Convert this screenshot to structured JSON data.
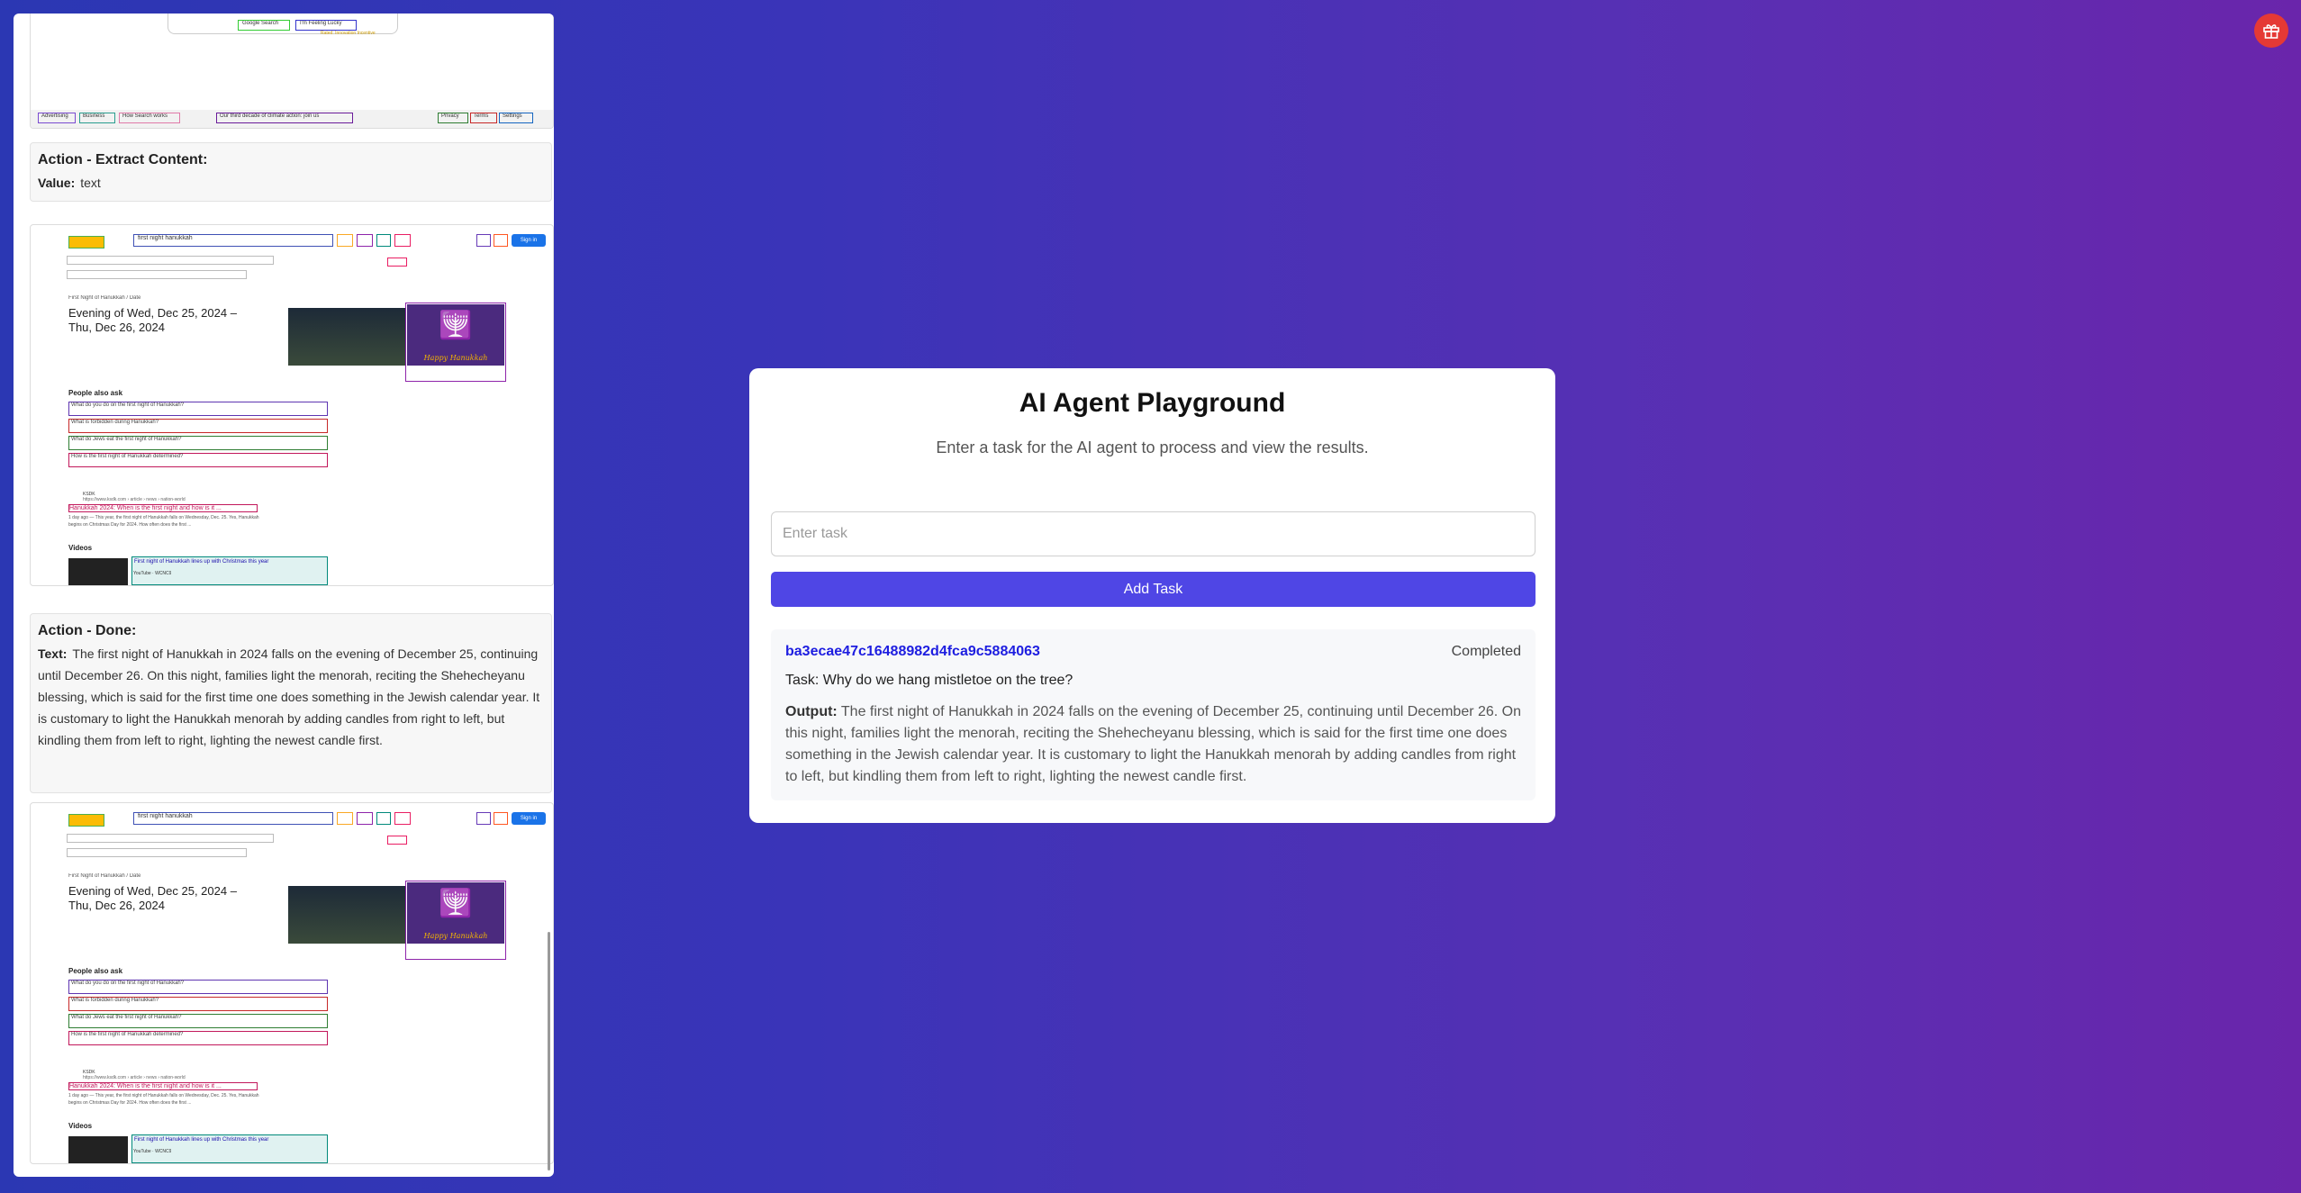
{
  "left_panel": {
    "top_shot": {
      "buttons": [
        "Google Search",
        "I'm Feeling Lucky"
      ],
      "footer_links": [
        "Advertising",
        "Business",
        "How Search works",
        "Our third decade of climate action: join us",
        "Privacy",
        "Terms",
        "Settings"
      ],
      "notice": "Rated: Innovation Incentive"
    },
    "extract_action": {
      "title": "Action - Extract Content:",
      "value_label": "Value:",
      "value": "text"
    },
    "search_shot": {
      "query": "first night hanukkah",
      "sign_in": "Sign in",
      "breadcrumb": "First Night of Hanukkah  /  Date",
      "date_heading_1": "Evening of Wed, Dec 25, 2024 –",
      "date_heading_2": "Thu, Dec 26, 2024",
      "people_also_ask": "People also ask",
      "questions": [
        "What do you do on the first night of Hanukkah?",
        "What is forbidden during Hanukkah?",
        "What do Jews eat the first night of Hanukkah?",
        "How is the first night of Hanukkah determined?"
      ],
      "result_source": "KSDK",
      "result_url": "https://www.ksdk.com › article › news › nation-world",
      "result_title": "Hanukkah 2024: When is the first night and how is it ...",
      "result_snippet_1": "1 day ago — This year, the first night of Hanukkah falls on Wednesday, Dec. 25. Yes, Hanukkah",
      "result_snippet_2": "begins on Christmas Day for 2024. How often does the first ...",
      "videos": "Videos",
      "video_title": "First night of Hanukkah lines up with Christmas this year",
      "video_source": "YouTube · WCNC9",
      "menorah_text": "Happy Hanukkah"
    },
    "done_action": {
      "title": "Action - Done:",
      "text_label": "Text:",
      "text": "The first night of Hanukkah in 2024 falls on the evening of December 25, continuing until December 26. On this night, families light the menorah, reciting the Shehecheyanu blessing, which is said for the first time one does something in the Jewish calendar year. It is customary to light the Hanukkah menorah by adding candles from right to left, but kindling them from left to right, lighting the newest candle first."
    }
  },
  "main": {
    "title": "AI Agent Playground",
    "subtitle": "Enter a task for the AI agent to process and view the results.",
    "input_placeholder": "Enter task",
    "add_button": "Add Task",
    "result": {
      "task_id": "ba3ecae47c16488982d4fca9c5884063",
      "status": "Completed",
      "task_text": "Task: Why do we hang mistletoe on the tree?",
      "output_label": "Output:",
      "output_text": "The first night of Hanukkah in 2024 falls on the evening of December 25, continuing until December 26. On this night, families light the menorah, reciting the Shehecheyanu blessing, which is said for the first time one does something in the Jewish calendar year. It is customary to light the Hanukkah menorah by adding candles from right to left, but kindling them from left to right, lighting the newest candle first."
    }
  },
  "icons": {
    "corner_button": "gift-icon"
  },
  "colors": {
    "accent": "#4f46e5",
    "task_id": "#1d1de0",
    "gift_button": "#e53935"
  }
}
